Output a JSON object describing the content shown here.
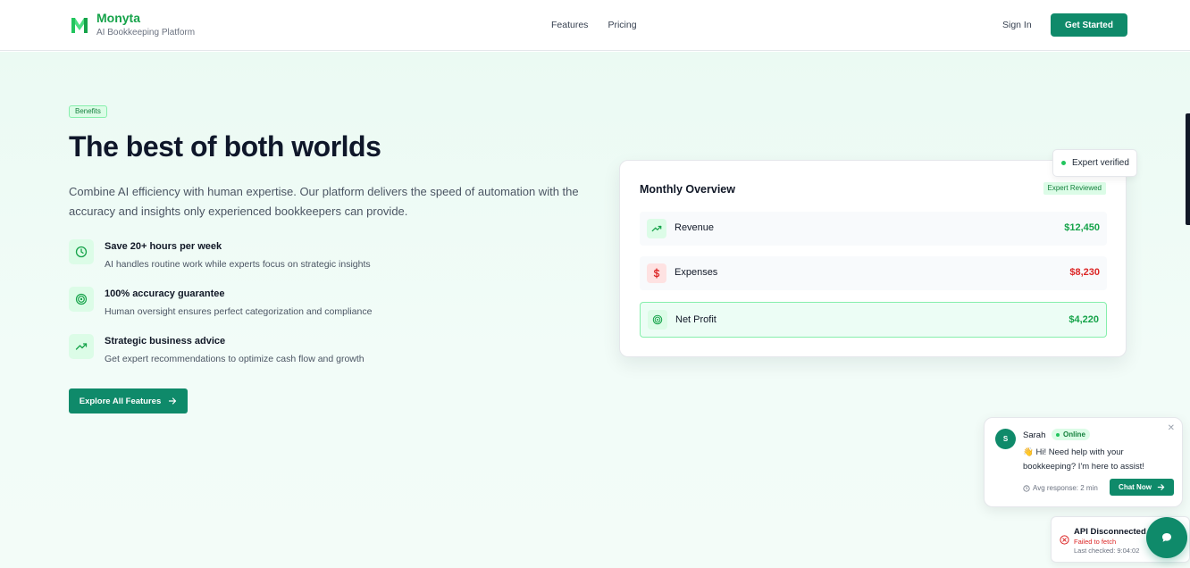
{
  "header": {
    "brand_name": "Monyta",
    "brand_tagline": "AI Bookkeeping Platform",
    "nav": [
      {
        "label": "Features"
      },
      {
        "label": "Pricing"
      }
    ],
    "sign_in": "Sign In",
    "get_started": "Get Started"
  },
  "hero": {
    "badge": "Benefits",
    "title": "The best of both worlds",
    "description": "Combine AI efficiency with human expertise. Our platform delivers the speed of automation with the accuracy and insights only experienced bookkeepers can provide.",
    "features": [
      {
        "icon": "clock-icon",
        "title": "Save 20+ hours per week",
        "subtitle": "AI handles routine work while experts focus on strategic insights"
      },
      {
        "icon": "target-icon",
        "title": "100% accuracy guarantee",
        "subtitle": "Human oversight ensures perfect categorization and compliance"
      },
      {
        "icon": "trending-up-icon",
        "title": "Strategic business advice",
        "subtitle": "Get expert recommendations to optimize cash flow and growth"
      }
    ],
    "cta": "Explore All Features"
  },
  "overview": {
    "title": "Monthly Overview",
    "badge": "Expert Reviewed",
    "verified_label": "Expert verified",
    "rows": [
      {
        "icon": "trending-up-icon",
        "label": "Revenue",
        "value": "$12,450",
        "color": "#16a34a"
      },
      {
        "icon": "dollar-icon",
        "label": "Expenses",
        "value": "$8,230",
        "color": "#dc2626"
      },
      {
        "icon": "target-icon",
        "label": "Net Profit",
        "value": "$4,220",
        "color": "#16a34a"
      }
    ]
  },
  "chat": {
    "avatar_initial": "S",
    "agent_name": "Sarah",
    "status": "Online",
    "emoji": "👋",
    "message": "Hi! Need help with your bookkeeping? I'm here to assist!",
    "avg_response": "Avg response: 2 min",
    "button": "Chat Now"
  },
  "api_status": {
    "title": "API Disconnected",
    "error": "Failed to fetch",
    "last_checked": "Last checked: 9:04:02"
  },
  "colors": {
    "brand": "#0f8a6a",
    "accent_green": "#16a34a",
    "danger": "#dc2626",
    "hero_bg": "#ebfaf3"
  }
}
